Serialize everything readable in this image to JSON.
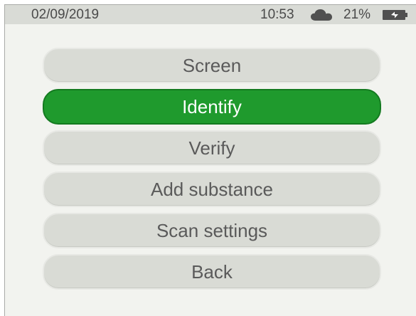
{
  "status_bar": {
    "date": "02/09/2019",
    "time": "10:53",
    "battery_percent": "21%",
    "icons": [
      "cloud-icon",
      "battery-charging-icon"
    ]
  },
  "menu": {
    "items": [
      {
        "label": "Screen",
        "selected": false
      },
      {
        "label": "Identify",
        "selected": true
      },
      {
        "label": "Verify",
        "selected": false
      },
      {
        "label": "Add substance",
        "selected": false
      },
      {
        "label": "Scan settings",
        "selected": false
      },
      {
        "label": "Back",
        "selected": false
      }
    ]
  },
  "colors": {
    "selected_button": "#1f9a2d",
    "button": "#d9dbd5",
    "status_bar": "#d9dbd6",
    "background": "#f2f3ef"
  }
}
